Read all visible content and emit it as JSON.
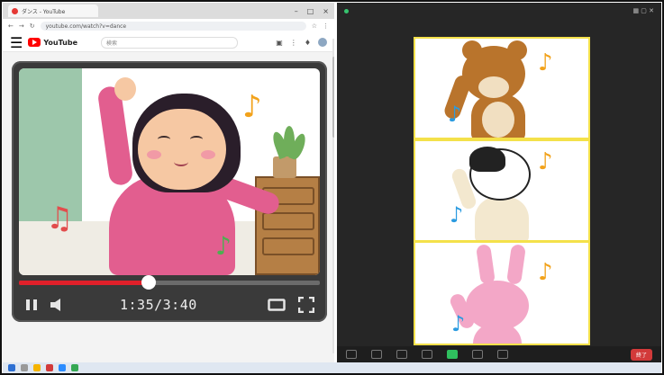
{
  "browser": {
    "tab_title": "ダンス - YouTube",
    "url": "youtube.com/watch?v=dance",
    "yt_logo": "YouTube",
    "search_placeholder": "検索"
  },
  "player": {
    "time_label": "1:35/3:40",
    "progress": 0.4318
  },
  "zoom": {
    "end_label": "終了"
  },
  "icons": {
    "note_orange": "♪",
    "note_red": "♫",
    "note_green": "♪",
    "note_blue": "♪"
  },
  "colors": {
    "youtube_red": "#e0202a",
    "zoom_bg": "#262626",
    "tile_border": "#f4e14a",
    "note_orange": "#f2a21b",
    "note_red": "#e24c4c",
    "note_green": "#4caf50",
    "note_blue": "#2b9be0"
  }
}
